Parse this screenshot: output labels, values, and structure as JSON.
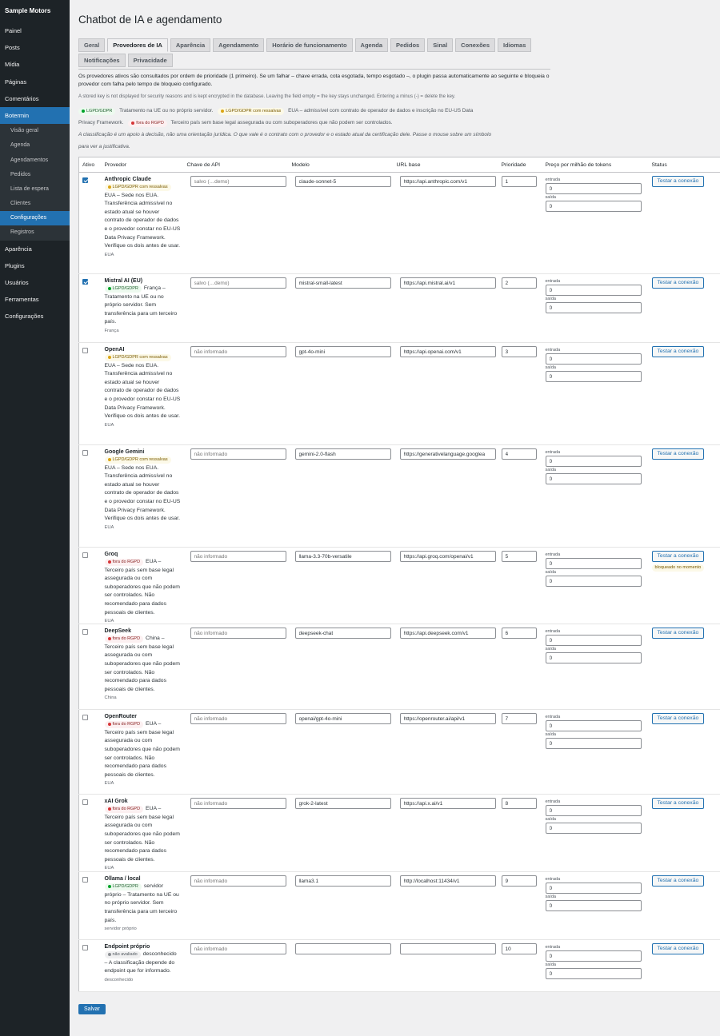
{
  "sidebar": {
    "site": "Sample Motors",
    "items": [
      "Painel",
      "Posts",
      "Mídia",
      "Páginas",
      "Comentários"
    ],
    "active": "Botermin",
    "sub": [
      "Visão geral",
      "Agenda",
      "Agendamentos",
      "Pedidos",
      "Lista de espera",
      "Clientes",
      "Configurações",
      "Registros"
    ],
    "after": [
      "Aparência",
      "Plugins",
      "Usuários",
      "Ferramentas",
      "Configurações"
    ]
  },
  "page": {
    "title": "Chatbot de IA e agendamento"
  },
  "tabs": [
    "Geral",
    "Provedores de IA",
    "Aparência",
    "Agendamento",
    "Horário de funcionamento",
    "Agenda",
    "Pedidos",
    "Sinal",
    "Conexões",
    "Idiomas",
    "Notificações",
    "Privacidade"
  ],
  "intro": {
    "p1": "Os provedores ativos são consultados por ordem de prioridade (1 primeiro). Se um falhar – chave errada, cota esgotada, tempo esgotado –, o plugin passa automaticamente ao seguinte e bloqueia o provedor com falha pelo tempo de bloqueio configurado.",
    "p2": "A stored key is not displayed for security reasons and is kept encrypted in the database. Leaving the field empty = the key stays unchanged. Entering a minus (-) = delete the key."
  },
  "legend": {
    "green_badge": "LGPD/GDPR",
    "green_text": "Tratamento na UE ou no próprio servidor.",
    "amber_badge": "LGPD/GDPR com ressalvas",
    "amber_text": "EUA – admissível com contrato de operador de dados e inscrição no EU-US Data Privacy Framework.",
    "red_badge": "fora do RGPD",
    "red_text": "Terceiro país sem base legal assegurada ou com suboperadores que não podem ser controlados."
  },
  "note": "A classificação é um apoio à decisão, não uma orientação jurídica. O que vale é o contrato com o provedor e o estado atual da certificação dele. Passe o mouse sobre um símbolo para ver a justificativa.",
  "columns": [
    "Ativo",
    "Provedor",
    "Chave de API",
    "Modelo",
    "URL base",
    "Prioridade",
    "Preço por milhão de tokens",
    "Status"
  ],
  "price_labels": {
    "in": "entrada",
    "out": "saída"
  },
  "test_label": "Testar a conexão",
  "save_label": "Salvar",
  "providers": [
    {
      "active": true,
      "name": "Anthropic Claude",
      "badge": "LGPD/GDPR com ressalvas",
      "badge_color": "amber",
      "desc": "EUA – Sede nos EUA. Transferência admissível no estado atual se houver contrato de operador de dados e o provedor constar no EU-US Data Privacy Framework. Verifique os dois antes de usar.",
      "region": "EUA",
      "key": "salvo (…demo)",
      "model": "claude-sonnet-5",
      "url": "https://api.anthropic.com/v1",
      "priority": "1",
      "in": "0",
      "out": "0",
      "status": ""
    },
    {
      "active": true,
      "name": "Mistral AI (EU)",
      "badge": "LGPD/GDPR",
      "badge_color": "green",
      "desc": "França – Tratamento na UE ou no próprio servidor. Sem transferência para um terceiro país.",
      "region": "França",
      "key": "salvo (…demo)",
      "model": "mistral-small-latest",
      "url": "https://api.mistral.ai/v1",
      "priority": "2",
      "in": "0",
      "out": "0",
      "status": ""
    },
    {
      "active": false,
      "name": "OpenAI",
      "badge": "LGPD/GDPR com ressalvas",
      "badge_color": "amber",
      "desc": "EUA – Sede nos EUA. Transferência admissível no estado atual se houver contrato de operador de dados e o provedor constar no EU-US Data Privacy Framework. Verifique os dois antes de usar.",
      "region": "EUA",
      "key": "não informado",
      "model": "gpt-4o-mini",
      "url": "https://api.openai.com/v1",
      "priority": "3",
      "in": "0",
      "out": "0",
      "status": ""
    },
    {
      "active": false,
      "name": "Google Gemini",
      "badge": "LGPD/GDPR com ressalvas",
      "badge_color": "amber",
      "desc": "EUA – Sede nos EUA. Transferência admissível no estado atual se houver contrato de operador de dados e o provedor constar no EU-US Data Privacy Framework. Verifique os dois antes de usar.",
      "region": "EUA",
      "key": "não informado",
      "model": "gemini-2.0-flash",
      "url": "https://generativelanguage.googlea",
      "priority": "4",
      "in": "0",
      "out": "0",
      "status": ""
    },
    {
      "active": false,
      "name": "Groq",
      "badge": "fora do RGPD",
      "badge_color": "red",
      "desc": "EUA – Terceiro país sem base legal assegurada ou com suboperadores que não podem ser controlados. Não recomendado para dados pessoais de clientes.",
      "region": "EUA",
      "key": "não informado",
      "model": "llama-3.3-70b-versatile",
      "url": "https://api.groq.com/openai/v1",
      "priority": "5",
      "in": "0",
      "out": "0",
      "status": "bloqueado no momento"
    },
    {
      "active": false,
      "name": "DeepSeek",
      "badge": "fora do RGPD",
      "badge_color": "red",
      "desc": "China – Terceiro país sem base legal assegurada ou com suboperadores que não podem ser controlados. Não recomendado para dados pessoais de clientes.",
      "region": "China",
      "key": "não informado",
      "model": "deepseek-chat",
      "url": "https://api.deepseek.com/v1",
      "priority": "6",
      "in": "0",
      "out": "0",
      "status": ""
    },
    {
      "active": false,
      "name": "OpenRouter",
      "badge": "fora do RGPD",
      "badge_color": "red",
      "desc": "EUA – Terceiro país sem base legal assegurada ou com suboperadores que não podem ser controlados. Não recomendado para dados pessoais de clientes.",
      "region": "EUA",
      "key": "não informado",
      "model": "openai/gpt-4o-mini",
      "url": "https://openrouter.ai/api/v1",
      "priority": "7",
      "in": "0",
      "out": "0",
      "status": ""
    },
    {
      "active": false,
      "name": "xAI Grok",
      "badge": "fora do RGPD",
      "badge_color": "red",
      "desc": "EUA – Terceiro país sem base legal assegurada ou com suboperadores que não podem ser controlados. Não recomendado para dados pessoais de clientes.",
      "region": "EUA",
      "key": "não informado",
      "model": "grok-2-latest",
      "url": "https://api.x.ai/v1",
      "priority": "8",
      "in": "0",
      "out": "0",
      "status": ""
    },
    {
      "active": false,
      "name": "Ollama / local",
      "badge": "LGPD/GDPR",
      "badge_color": "green",
      "desc": "servidor próprio – Tratamento na UE ou no próprio servidor. Sem transferência para um terceiro país.",
      "region": "servidor próprio",
      "key": "não informado",
      "model": "llama3.1",
      "url": "http://localhost:11434/v1",
      "priority": "9",
      "in": "0",
      "out": "0",
      "status": ""
    },
    {
      "active": false,
      "name": "Endpoint próprio",
      "badge": "não avaliado",
      "badge_color": "gray",
      "desc": "desconhecido – A classificação depende do endpoint que for informado.",
      "region": "desconhecido",
      "key": "não informado",
      "model": "",
      "url": "",
      "priority": "10",
      "in": "0",
      "out": "0",
      "status": ""
    }
  ]
}
